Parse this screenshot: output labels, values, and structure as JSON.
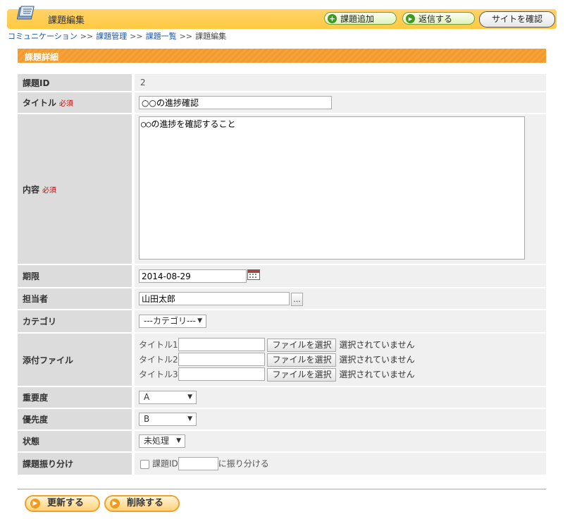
{
  "header": {
    "title": "課題編集",
    "buttons": {
      "add": "課題追加",
      "reply": "返信する",
      "site": "サイトを確認"
    }
  },
  "breadcrumb": {
    "items": [
      "コミュニケーション",
      "課題管理",
      "課題一覧"
    ],
    "separator": ">>",
    "current": "課題編集"
  },
  "section": {
    "title": "課題詳細"
  },
  "form": {
    "required_mark": "必須",
    "id": {
      "label": "課題ID",
      "value": "2"
    },
    "title": {
      "label": "タイトル",
      "value": "○○の進捗確認"
    },
    "content": {
      "label": "内容",
      "value": "○○の進捗を確認すること"
    },
    "due": {
      "label": "期限",
      "value": "2014-08-29"
    },
    "assignee": {
      "label": "担当者",
      "value": "山田太郎",
      "button": "..."
    },
    "category": {
      "label": "カテゴリ",
      "value": "---カテゴリ---"
    },
    "attachments": {
      "label": "添付ファイル",
      "button": "ファイルを選択",
      "status": "選択されていません",
      "rows": [
        "タイトル1",
        "タイトル2",
        "タイトル3"
      ]
    },
    "importance": {
      "label": "重要度",
      "value": "A"
    },
    "priority": {
      "label": "優先度",
      "value": "B"
    },
    "status": {
      "label": "状態",
      "value": "未処理"
    },
    "assign": {
      "label": "課題振り分け",
      "prefix": "課題ID",
      "suffix": "に振り分ける",
      "value": ""
    }
  },
  "actions": {
    "update": "更新する",
    "delete": "削除する"
  },
  "colors": {
    "accent": "#f29a2e",
    "header": "#ffc940",
    "link": "#1a55a8",
    "required": "#cc0000"
  }
}
